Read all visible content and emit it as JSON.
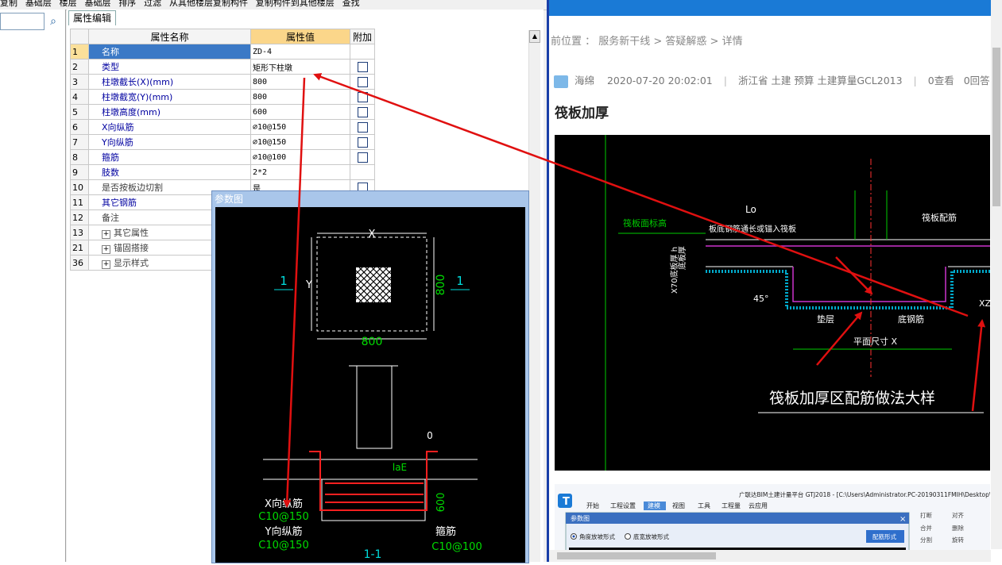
{
  "left_app": {
    "toolbar": [
      "复制",
      "基础层",
      "楼层",
      "基础层",
      "排序",
      "过滤",
      "从其他楼层复制构件",
      "复制构件到其他楼层",
      "查找"
    ],
    "prop_tab": "属性编辑",
    "table": {
      "headers": [
        "属性名称",
        "属性值",
        "附加"
      ],
      "rows": [
        {
          "num": "1",
          "name": "名称",
          "value": "ZD-4",
          "check": false,
          "selected": true
        },
        {
          "num": "2",
          "name": "类型",
          "value": "矩形下柱墩",
          "check": true
        },
        {
          "num": "3",
          "name": "柱墩截长(X)(mm)",
          "value": "800",
          "check": true
        },
        {
          "num": "4",
          "name": "柱墩截宽(Y)(mm)",
          "value": "800",
          "check": true
        },
        {
          "num": "5",
          "name": "柱墩高度(mm)",
          "value": "600",
          "check": true
        },
        {
          "num": "6",
          "name": "X向纵筋",
          "value": "⌀10@150",
          "check": true
        },
        {
          "num": "7",
          "name": "Y向纵筋",
          "value": "⌀10@150",
          "check": true
        },
        {
          "num": "8",
          "name": "箍筋",
          "value": "⌀10@100",
          "check": true
        },
        {
          "num": "9",
          "name": "肢数",
          "value": "2*2",
          "check": false
        },
        {
          "num": "10",
          "name": "是否按板边切割",
          "value": "是",
          "check": true,
          "black": true
        },
        {
          "num": "11",
          "name": "其它钢筋",
          "value": "",
          "check": false
        },
        {
          "num": "12",
          "name": "备注",
          "value": "",
          "check": false,
          "black": true
        },
        {
          "num": "13",
          "name": "其它属性",
          "value": "",
          "group": true
        },
        {
          "num": "21",
          "name": "锚固搭接",
          "value": "",
          "group": true
        },
        {
          "num": "36",
          "name": "显示样式",
          "value": "",
          "group": true
        }
      ]
    },
    "param_window": {
      "title": "参数图",
      "labels": {
        "x": "X",
        "y": "Y",
        "dim_800_right": "800",
        "dim_800_bottom": "800",
        "section_left": "1",
        "section_right": "1",
        "zero": "0",
        "lae": "laE",
        "dim_600": "600",
        "x_bar_label": "X向纵筋",
        "x_bar_value": "C10@150",
        "y_bar_label": "Y向纵筋",
        "y_bar_value": "C10@150",
        "stirrup_label": "箍筋",
        "stirrup_value": "C10@100",
        "section_name": "1-1"
      }
    }
  },
  "right_page": {
    "breadcrumb": "前位置 ： 服务新干线 > 答疑解惑 > 详情",
    "meta": {
      "author": "海绵",
      "datetime": "2020-07-20 20:02:01",
      "tags": "浙江省  土建 预算 土建算量GCL2013",
      "views": "0查看",
      "answers": "0回答"
    },
    "question_title": "筏板加厚",
    "cad": {
      "raft_top_label": "筏板面标高",
      "raft_rebar_label": "筏板配筋",
      "lo_label": "Lo",
      "angle_label": "45°",
      "cushion_label": "垫层",
      "bottom_bar_label": "底钢筋",
      "plan_dim_label": "平面尺寸 X",
      "title": "筏板加厚区配筋做法大样",
      "xz_label": "XZ",
      "thickness_label": "X70底板厚 h",
      "top_note": "板底钢筋通长或锚入筏板",
      "bottom_thick_label": "底板厚"
    },
    "screenshot2": {
      "app_title": "广联达BIM土建计量平台 GTJ2018 - [C:\\Users\\Administrator.PC-20190311FMIH\\Desktop\\",
      "menu": [
        "开始",
        "工程设置",
        "建模",
        "视图",
        "工具",
        "工程量",
        "云应用"
      ],
      "dialog_title": "参数图",
      "radio1": "角度放坡形式",
      "radio2": "底宽放坡形式",
      "button": "配筋形式",
      "right_tools": [
        "打断",
        "对齐",
        "合并",
        "删除",
        "分割",
        "旋转"
      ]
    }
  },
  "colors": {
    "selection": "#3b79c6",
    "header_value": "#fbd68a",
    "arrow": "#e01010",
    "top_bar": "#1a7ad6"
  }
}
